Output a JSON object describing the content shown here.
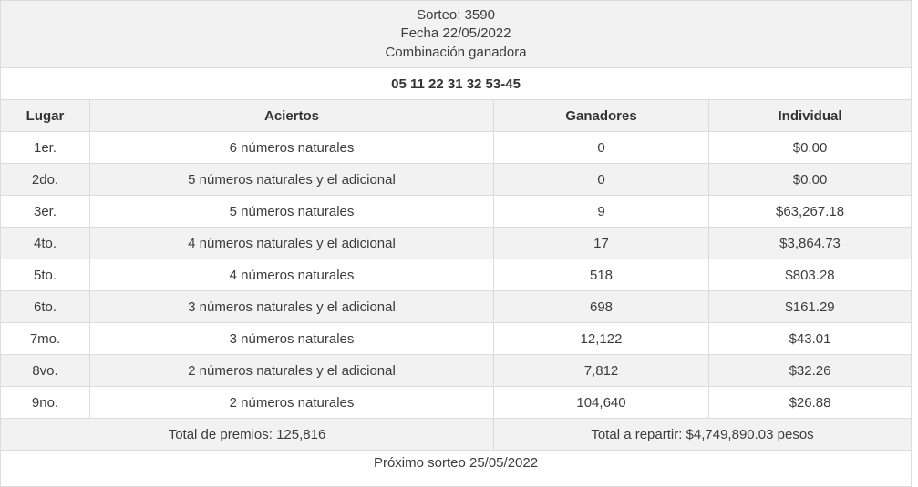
{
  "header": {
    "sorteo": "Sorteo: 3590",
    "fecha": "Fecha 22/05/2022",
    "combinacion_label": "Combinación ganadora"
  },
  "combination": "05 11 22 31 32 53-45",
  "columns": {
    "lugar": "Lugar",
    "aciertos": "Aciertos",
    "ganadores": "Ganadores",
    "individual": "Individual"
  },
  "rows": [
    {
      "lugar": "1er.",
      "aciertos": "6 números naturales",
      "ganadores": "0",
      "individual": "$0.00"
    },
    {
      "lugar": "2do.",
      "aciertos": "5 números naturales y el adicional",
      "ganadores": "0",
      "individual": "$0.00"
    },
    {
      "lugar": "3er.",
      "aciertos": "5 números naturales",
      "ganadores": "9",
      "individual": "$63,267.18"
    },
    {
      "lugar": "4to.",
      "aciertos": "4 números naturales y el adicional",
      "ganadores": "17",
      "individual": "$3,864.73"
    },
    {
      "lugar": "5to.",
      "aciertos": "4 números naturales",
      "ganadores": "518",
      "individual": "$803.28"
    },
    {
      "lugar": "6to.",
      "aciertos": "3 números naturales y el adicional",
      "ganadores": "698",
      "individual": "$161.29"
    },
    {
      "lugar": "7mo.",
      "aciertos": "3 números naturales",
      "ganadores": "12,122",
      "individual": "$43.01"
    },
    {
      "lugar": "8vo.",
      "aciertos": "2 números naturales y el adicional",
      "ganadores": "7,812",
      "individual": "$32.26"
    },
    {
      "lugar": "9no.",
      "aciertos": "2 números naturales",
      "ganadores": "104,640",
      "individual": "$26.88"
    }
  ],
  "totals": {
    "premios": "Total de premios: 125,816",
    "repartir": "Total a repartir: $4,749,890.03 pesos"
  },
  "next_draw": "Próximo sorteo 25/05/2022"
}
